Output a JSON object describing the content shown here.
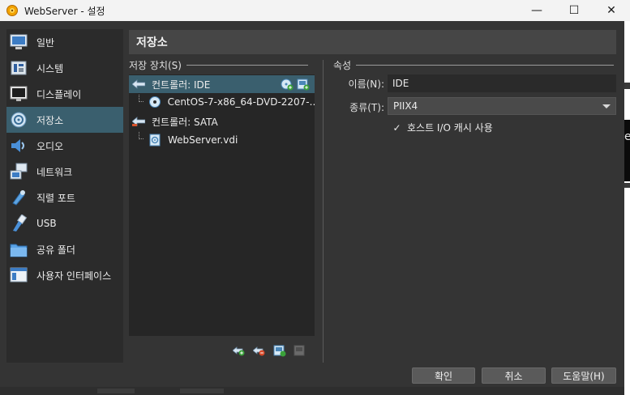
{
  "window": {
    "title": "WebServer - 설정",
    "minimize_glyph": "—",
    "maximize_glyph": "☐",
    "close_glyph": "✕"
  },
  "sidebar": {
    "items": [
      {
        "label": "일반",
        "icon": "general-icon",
        "active": false
      },
      {
        "label": "시스템",
        "icon": "system-icon",
        "active": false
      },
      {
        "label": "디스플레이",
        "icon": "display-icon",
        "active": false
      },
      {
        "label": "저장소",
        "icon": "storage-icon",
        "active": true
      },
      {
        "label": "오디오",
        "icon": "audio-icon",
        "active": false
      },
      {
        "label": "네트워크",
        "icon": "network-icon",
        "active": false
      },
      {
        "label": "직렬 포트",
        "icon": "serial-port-icon",
        "active": false
      },
      {
        "label": "USB",
        "icon": "usb-icon",
        "active": false
      },
      {
        "label": "공유 폴더",
        "icon": "shared-folder-icon",
        "active": false
      },
      {
        "label": "사용자 인터페이스",
        "icon": "user-interface-icon",
        "active": false
      }
    ]
  },
  "header": {
    "title": "저장소"
  },
  "storage_devices": {
    "title": "저장 장치(S)",
    "tree": [
      {
        "label": "컨트롤러: IDE",
        "type": "controller",
        "selected": true
      },
      {
        "label": "CentOS-7-x86_64-DVD-2207-...",
        "type": "optical",
        "selected": false
      },
      {
        "label": "컨트롤러: SATA",
        "type": "controller",
        "selected": false
      },
      {
        "label": "WebServer.vdi",
        "type": "hard-disk",
        "selected": false
      }
    ]
  },
  "attributes": {
    "title": "속성",
    "name_label": "이름(N):",
    "name_value": "IDE",
    "type_label": "종류(T):",
    "type_value": "PIIX4",
    "host_cache_label": "호스트 I/O 캐시 사용",
    "host_cache_checked": true,
    "check_glyph": "✓"
  },
  "buttons": {
    "ok": "확인",
    "cancel": "취소",
    "help": "도움말(H)"
  },
  "bleed": {
    "right_char": "e"
  },
  "colors": {
    "accent": "#3a5f6e",
    "window_bg": "#343434",
    "panel_bg": "#262626"
  }
}
